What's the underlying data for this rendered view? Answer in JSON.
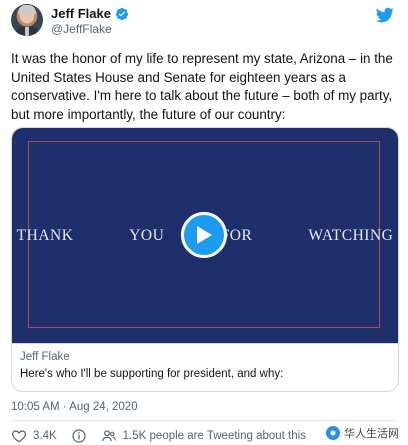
{
  "author": {
    "display_name": "Jeff Flake",
    "handle": "@JeffFlake",
    "verified": true
  },
  "tweet": {
    "text": "It was the honor of my life to represent my state, Arizona – in the United States House and Senate for eighteen years as a conservative. I'm here to talk about the future – both of my party, but more importantly, the future of our country:",
    "timestamp": "10:05 AM · Aug 24, 2020"
  },
  "media": {
    "video_caption": "THANK YOU FOR WATCHING",
    "card_author": "Jeff Flake",
    "card_title": "Here's who I'll be supporting for president, and why:"
  },
  "actions": {
    "likes": "3.4K",
    "people_tweeting": "1.5K people are Tweeting about this"
  },
  "watermark": {
    "text": "华人生活网"
  },
  "colors": {
    "accent": "#1d9bf0",
    "video_background": "#1f2f6b",
    "video_frame": "#b1455a"
  },
  "icons": {
    "header": [
      "verified-badge-icon",
      "twitter-bird-icon"
    ],
    "actions": [
      "heart-icon",
      "info-icon",
      "people-icon"
    ],
    "video": [
      "play-icon"
    ]
  }
}
